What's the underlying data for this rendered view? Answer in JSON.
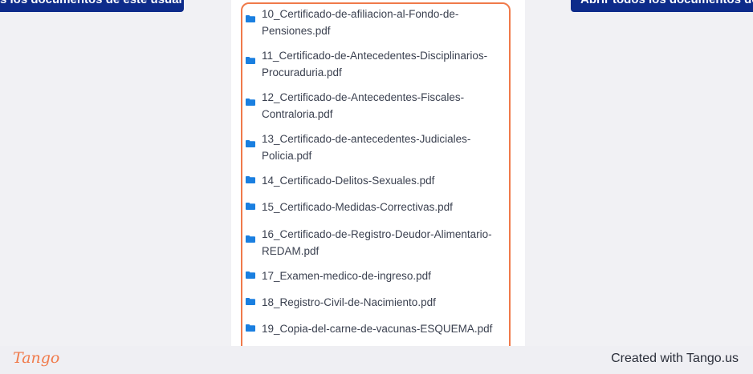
{
  "top_buttons": {
    "left_label": "s los documentos de este usuario",
    "right_label": "Abrir todos los documentos de e"
  },
  "files": [
    {
      "lines": [
        "10_Certificado-de-afiliacion-al-Fondo-de-",
        "Pensiones.pdf"
      ]
    },
    {
      "lines": [
        "11_Certificado-de-Antecedentes-Disciplinarios-",
        "Procuraduria.pdf"
      ]
    },
    {
      "lines": [
        "12_Certificado-de-Antecedentes-Fiscales-",
        "Contraloria.pdf"
      ]
    },
    {
      "lines": [
        "13_Certificado-de-antecedentes-Judiciales-",
        "Policia.pdf"
      ]
    },
    {
      "lines": [
        "14_Certificado-Delitos-Sexuales.pdf"
      ]
    },
    {
      "lines": [
        "15_Certificado-Medidas-Correctivas.pdf"
      ]
    },
    {
      "lines": [
        "16_Certificado-de-Registro-Deudor-Alimentario-",
        "REDAM.pdf"
      ]
    },
    {
      "lines": [
        "17_Examen-medico-de-ingreso.pdf"
      ]
    },
    {
      "lines": [
        "18_Registro-Civil-de-Nacimiento.pdf"
      ]
    },
    {
      "lines": [
        "19_Copia-del-carne-de-vacunas-ESQUEMA.pdf"
      ]
    }
  ],
  "icons": {
    "folder": "folder-icon"
  },
  "colors": {
    "button": "#0d2b8a",
    "folder": "#1a7fe0",
    "highlight": "#f07a4a"
  },
  "footer": {
    "logo": "Tango",
    "credit": "Created with Tango.us"
  }
}
